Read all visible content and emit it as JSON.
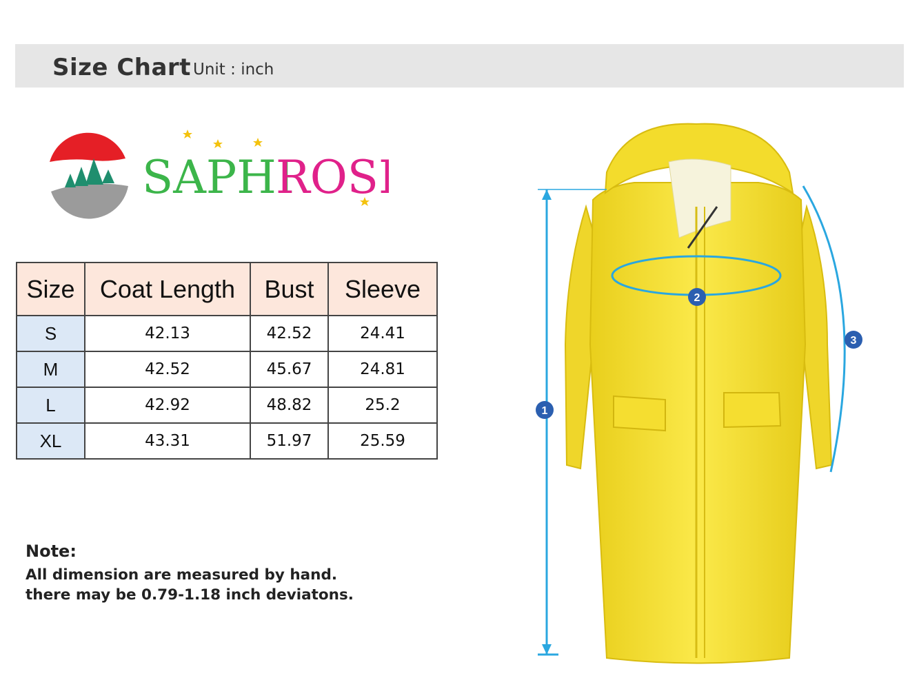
{
  "header": {
    "title": "Size Chart",
    "unit": "Unit : inch"
  },
  "brand": {
    "name": "SAPHI ROSE"
  },
  "table": {
    "headers": [
      "Size",
      "Coat Length",
      "Bust",
      "Sleeve"
    ],
    "rows": [
      {
        "size": "S",
        "length": "42.13",
        "bust": "42.52",
        "sleeve": "24.41"
      },
      {
        "size": "M",
        "length": "42.52",
        "bust": "45.67",
        "sleeve": "24.81"
      },
      {
        "size": "L",
        "length": "42.92",
        "bust": "48.82",
        "sleeve": "25.2"
      },
      {
        "size": "XL",
        "length": "43.31",
        "bust": "51.97",
        "sleeve": "25.59"
      }
    ]
  },
  "note": {
    "title": "Note:",
    "lines": [
      "All dimension are measured by hand.",
      "there may be 0.79-1.18 inch deviatons."
    ]
  },
  "markers": [
    "1",
    "2",
    "3"
  ],
  "colors": {
    "coat": "#f7e234",
    "measure": "#2aa7e0",
    "marker": "#2b5fb0",
    "header_bg": "#e6e6e6"
  }
}
